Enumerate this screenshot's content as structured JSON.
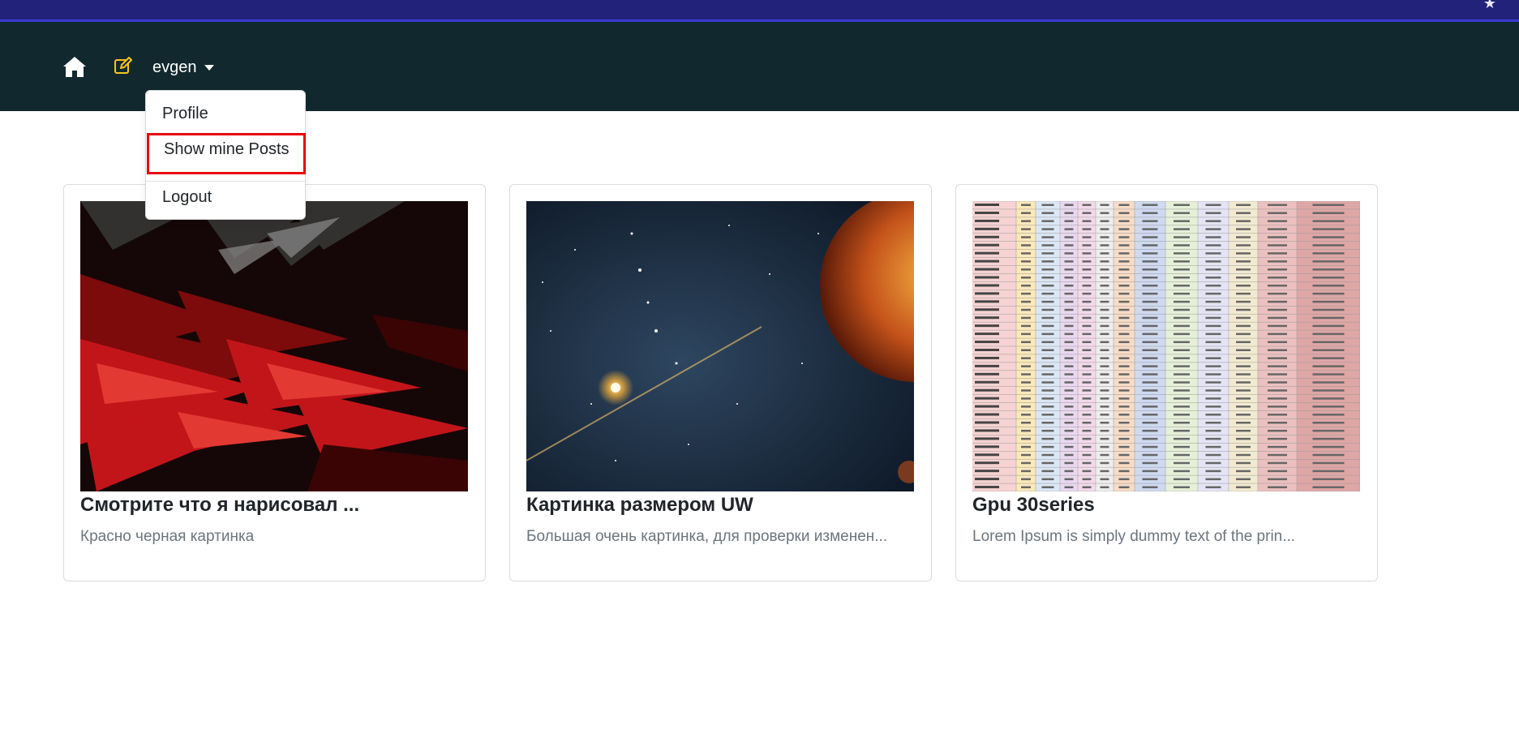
{
  "navbar": {
    "home_icon": "home-icon",
    "edit_icon": "edit-icon",
    "user_label": "evgen",
    "accent_color": "#f5c518",
    "background": "#11292e"
  },
  "dropdown": {
    "items": [
      {
        "label": "Profile"
      },
      {
        "label": "Show mine Posts",
        "highlighted": true
      },
      {
        "label": "Logout"
      }
    ],
    "highlight_color": "#e8000e"
  },
  "posts": [
    {
      "title": "Смотрите что я нарисовал ...",
      "text": "Красно черная картинка",
      "image": "red-black-abstract-image"
    },
    {
      "title": "Картинка размером UW",
      "text": "Большая очень картинка, для проверки изменен...",
      "image": "space-planet-image"
    },
    {
      "title": "Gpu 30series",
      "text": "Lorem Ipsum is simply dummy text of the prin...",
      "image": "gpu-spec-table-image"
    }
  ]
}
